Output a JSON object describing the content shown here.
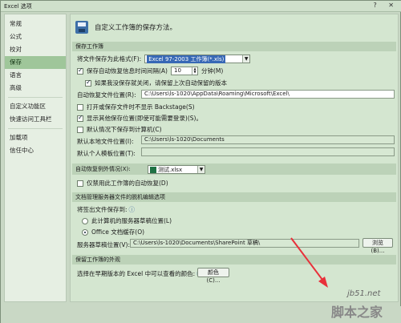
{
  "window": {
    "title": "Excel 选项",
    "controls": "? ✕"
  },
  "sidebar": {
    "items": [
      {
        "label": "常规",
        "active": false
      },
      {
        "label": "公式",
        "active": false
      },
      {
        "label": "校对",
        "active": false
      },
      {
        "label": "保存",
        "active": true
      },
      {
        "label": "语言",
        "active": false
      },
      {
        "label": "高级",
        "active": false
      },
      {
        "label": "自定义功能区",
        "active": false
      },
      {
        "label": "快速访问工具栏",
        "active": false
      },
      {
        "label": "加载项",
        "active": false
      },
      {
        "label": "信任中心",
        "active": false
      }
    ]
  },
  "header": {
    "text": "自定义工作簿的保存方法。"
  },
  "save_workbooks": {
    "section_title": "保存工作簿",
    "format_label": "将文件保存为此格式(F):",
    "format_value": "Excel 97-2003 工作簿(*.xls)",
    "autorecover_label": "保存自动恢复信息时间间隔(A)",
    "autorecover_minutes": "10",
    "minutes_label": "分钟(M)",
    "keep_last_label": "如果我没保存就关闭，请保留上次自动保留的版本",
    "autorecover_location_label": "自动恢复文件位置(R):",
    "autorecover_location_value": "C:\\Users\\ls-1020\\AppData\\Roaming\\Microsoft\\Excel\\",
    "no_backstage_label": "打开或保存文件时不显示 Backstage(S)",
    "show_other_locations_label": "显示其他保存位置(即使可能需要登录)(S)。",
    "save_to_computer_label": "默认情况下保存到计算机(C)",
    "default_local_label": "默认本地文件位置(I):",
    "default_local_value": "C:\\Users\\ls-1020\\Documents",
    "default_template_label": "默认个人模板位置(T):",
    "default_template_value": ""
  },
  "autorecover_exceptions": {
    "section_title": "自动恢复例外情况(X):",
    "workbook_value": "测试.xlsx",
    "disable_label": "仅禁用此工作簿的自动恢复(D)"
  },
  "offline_editing": {
    "section_title": "文档管理服务器文件的脱机编辑选项",
    "save_checked_out_label": "将签出文件保存到:",
    "radio_server_drafts": "此计算机的服务器草稿位置(L)",
    "radio_office_cache": "Office 文档缓存(O)",
    "server_drafts_label": "服务器草稿位置(V):",
    "server_drafts_value": "C:\\Users\\ls-1020\\Documents\\SharePoint 草稿\\",
    "browse_label": "浏览(B)..."
  },
  "visual_appearance": {
    "section_title": "保留工作簿的外观",
    "colors_prompt": "选择在早期版本的 Excel 中可以查看的颜色:",
    "colors_button": "颜色(C)..."
  },
  "watermark": {
    "site": "jb51.net",
    "brand": "脚本之家"
  },
  "colors": {
    "accent": "#9fc69a",
    "selection": "#3768b5",
    "arrow": "#e8303a"
  }
}
